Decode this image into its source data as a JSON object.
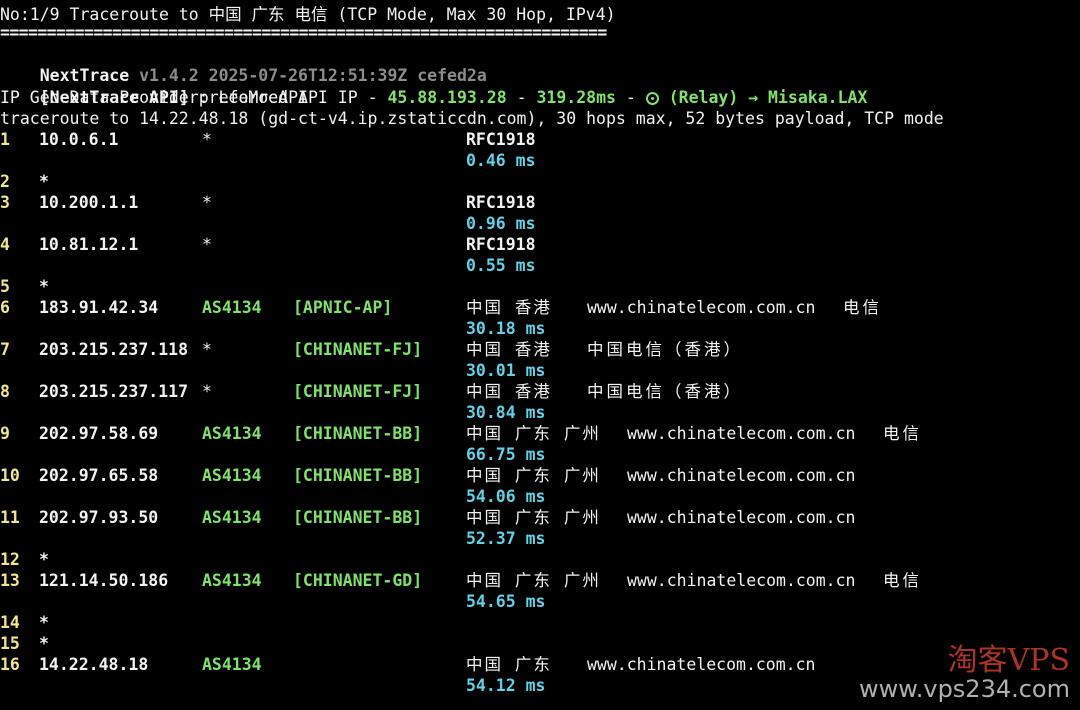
{
  "header": {
    "title_line": "No:1/9 Traceroute to 中国 广东 电信 (TCP Mode, Max 30 Hop, IPv4)",
    "separator": "=================================================================",
    "app_name": "NextTrace",
    "version_info": "v1.4.2 2025-07-26T12:51:39Z cefed2a",
    "api_label": "[NextTrace API]",
    "api_text": "preferred API IP - ",
    "api_ip": "45.88.193.28",
    "api_dash": " - ",
    "api_latency": "319.28ms",
    "api_dash2": " - ",
    "relay_text": "(Relay) → Misaka.LAX",
    "geo_provider": "IP Geo Data Provider: LeoMoeAPI",
    "trace_info": "traceroute to 14.22.48.18 (gd-ct-v4.ip.zstaticcdn.com), 30 hops max, 52 bytes payload, TCP mode"
  },
  "hops": [
    {
      "num": "1",
      "ip": "10.0.6.1",
      "as": "*",
      "net": "",
      "geo": "RFC1918",
      "domain": "",
      "isp": "",
      "ms": "0.46 ms",
      "rfc": true
    },
    {
      "num": "2",
      "ip": "*",
      "as": "",
      "net": "",
      "geo": "",
      "domain": "",
      "isp": "",
      "ms": ""
    },
    {
      "num": "3",
      "ip": "10.200.1.1",
      "as": "*",
      "net": "",
      "geo": "RFC1918",
      "domain": "",
      "isp": "",
      "ms": "0.96 ms",
      "rfc": true
    },
    {
      "num": "4",
      "ip": "10.81.12.1",
      "as": "*",
      "net": "",
      "geo": "RFC1918",
      "domain": "",
      "isp": "",
      "ms": "0.55 ms",
      "rfc": true
    },
    {
      "num": "5",
      "ip": "*",
      "as": "",
      "net": "",
      "geo": "",
      "domain": "",
      "isp": "",
      "ms": ""
    },
    {
      "num": "6",
      "ip": "183.91.42.34",
      "as": "AS4134",
      "net": "[APNIC-AP]",
      "geo": "中国 香港",
      "domain": "www.chinatelecom.com.cn",
      "isp": "电信",
      "ms": "30.18 ms"
    },
    {
      "num": "7",
      "ip": "203.215.237.118",
      "as": "*",
      "net": "[CHINANET-FJ]",
      "geo": "中国 香港",
      "domain": "中国电信（香港）",
      "isp": "",
      "ms": "30.01 ms"
    },
    {
      "num": "8",
      "ip": "203.215.237.117",
      "as": "*",
      "net": "[CHINANET-FJ]",
      "geo": "中国 香港",
      "domain": "中国电信（香港）",
      "isp": "",
      "ms": "30.84 ms"
    },
    {
      "num": "9",
      "ip": "202.97.58.69",
      "as": "AS4134",
      "net": "[CHINANET-BB]",
      "geo": "中国 广东 广州",
      "domain": "www.chinatelecom.com.cn",
      "isp": "电信",
      "ms": "66.75 ms"
    },
    {
      "num": "10",
      "ip": "202.97.65.58",
      "as": "AS4134",
      "net": "[CHINANET-BB]",
      "geo": "中国 广东 广州",
      "domain": "www.chinatelecom.com.cn",
      "isp": "",
      "ms": "54.06 ms"
    },
    {
      "num": "11",
      "ip": "202.97.93.50",
      "as": "AS4134",
      "net": "[CHINANET-BB]",
      "geo": "中国 广东 广州",
      "domain": "www.chinatelecom.com.cn",
      "isp": "",
      "ms": "52.37 ms"
    },
    {
      "num": "12",
      "ip": "*",
      "as": "",
      "net": "",
      "geo": "",
      "domain": "",
      "isp": "",
      "ms": ""
    },
    {
      "num": "13",
      "ip": "121.14.50.186",
      "as": "AS4134",
      "net": "[CHINANET-GD]",
      "geo": "中国 广东 广州",
      "domain": "www.chinatelecom.com.cn",
      "isp": "电信",
      "ms": "54.65 ms"
    },
    {
      "num": "14",
      "ip": "*",
      "as": "",
      "net": "",
      "geo": "",
      "domain": "",
      "isp": "",
      "ms": ""
    },
    {
      "num": "15",
      "ip": "*",
      "as": "",
      "net": "",
      "geo": "",
      "domain": "",
      "isp": "",
      "ms": ""
    },
    {
      "num": "16",
      "ip": "14.22.48.18",
      "as": "AS4134",
      "net": "",
      "geo": "中国 广东",
      "domain": "www.chinatelecom.com.cn",
      "isp": "",
      "ms": "54.12 ms"
    }
  ],
  "watermark": {
    "brand": "淘客VPS",
    "url": "www.vps234.com"
  },
  "colors": {
    "background": "#000000",
    "green": "#7fe36a",
    "cyan": "#5fd3e6",
    "yellow": "#f0e68c"
  }
}
